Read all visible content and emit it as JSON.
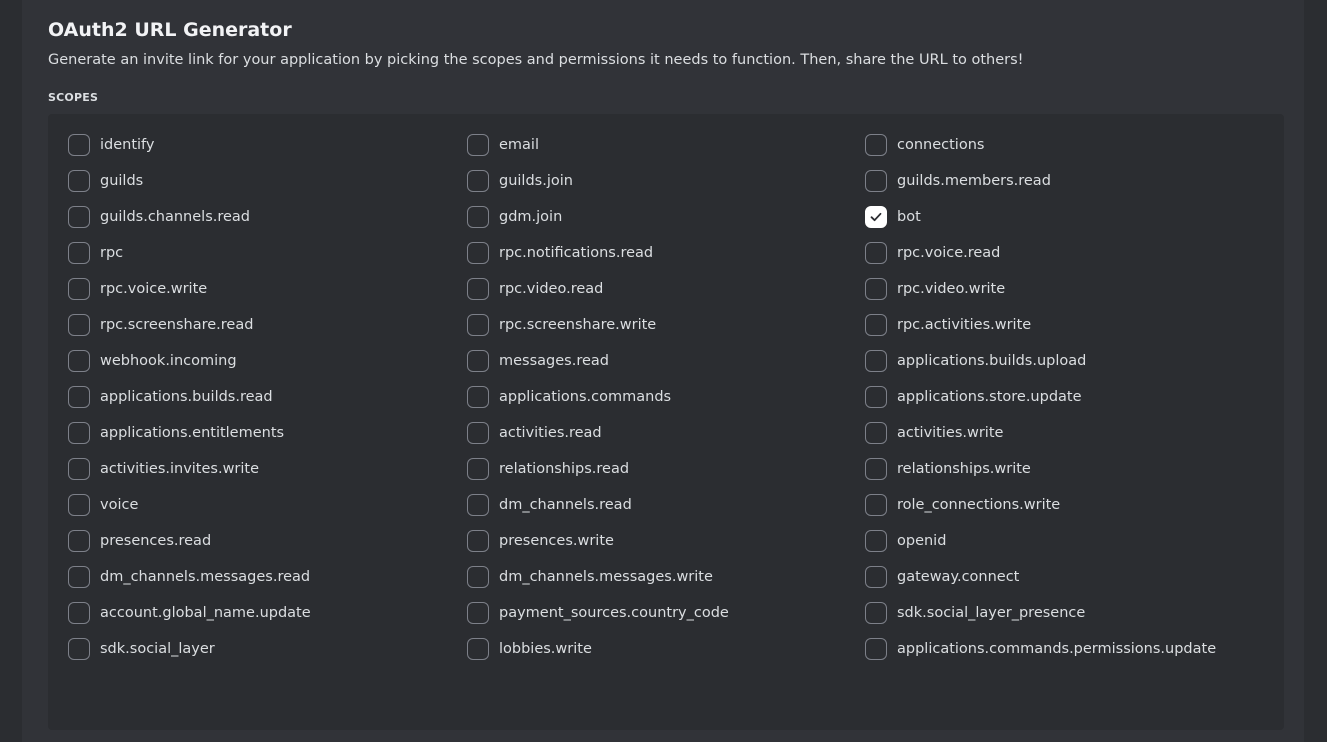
{
  "header": {
    "title": "OAuth2 URL Generator",
    "description": "Generate an invite link for your application by picking the scopes and permissions it needs to function. Then, share the URL to others!"
  },
  "scopes": {
    "label": "SCOPES",
    "items": [
      {
        "id": "identify",
        "label": "identify",
        "checked": false
      },
      {
        "id": "email",
        "label": "email",
        "checked": false
      },
      {
        "id": "connections",
        "label": "connections",
        "checked": false
      },
      {
        "id": "guilds",
        "label": "guilds",
        "checked": false
      },
      {
        "id": "guilds-join",
        "label": "guilds.join",
        "checked": false
      },
      {
        "id": "guilds-members-read",
        "label": "guilds.members.read",
        "checked": false
      },
      {
        "id": "guilds-channels-read",
        "label": "guilds.channels.read",
        "checked": false
      },
      {
        "id": "gdm-join",
        "label": "gdm.join",
        "checked": false
      },
      {
        "id": "bot",
        "label": "bot",
        "checked": true
      },
      {
        "id": "rpc",
        "label": "rpc",
        "checked": false
      },
      {
        "id": "rpc-notifications-read",
        "label": "rpc.notifications.read",
        "checked": false
      },
      {
        "id": "rpc-voice-read",
        "label": "rpc.voice.read",
        "checked": false
      },
      {
        "id": "rpc-voice-write",
        "label": "rpc.voice.write",
        "checked": false
      },
      {
        "id": "rpc-video-read",
        "label": "rpc.video.read",
        "checked": false
      },
      {
        "id": "rpc-video-write",
        "label": "rpc.video.write",
        "checked": false
      },
      {
        "id": "rpc-screenshare-read",
        "label": "rpc.screenshare.read",
        "checked": false
      },
      {
        "id": "rpc-screenshare-write",
        "label": "rpc.screenshare.write",
        "checked": false
      },
      {
        "id": "rpc-activities-write",
        "label": "rpc.activities.write",
        "checked": false
      },
      {
        "id": "webhook-incoming",
        "label": "webhook.incoming",
        "checked": false
      },
      {
        "id": "messages-read",
        "label": "messages.read",
        "checked": false
      },
      {
        "id": "applications-builds-upload",
        "label": "applications.builds.upload",
        "checked": false
      },
      {
        "id": "applications-builds-read",
        "label": "applications.builds.read",
        "checked": false
      },
      {
        "id": "applications-commands",
        "label": "applications.commands",
        "checked": false
      },
      {
        "id": "applications-store-update",
        "label": "applications.store.update",
        "checked": false
      },
      {
        "id": "applications-entitlements",
        "label": "applications.entitlements",
        "checked": false
      },
      {
        "id": "activities-read",
        "label": "activities.read",
        "checked": false
      },
      {
        "id": "activities-write",
        "label": "activities.write",
        "checked": false
      },
      {
        "id": "activities-invites-write",
        "label": "activities.invites.write",
        "checked": false
      },
      {
        "id": "relationships-read",
        "label": "relationships.read",
        "checked": false
      },
      {
        "id": "relationships-write",
        "label": "relationships.write",
        "checked": false
      },
      {
        "id": "voice",
        "label": "voice",
        "checked": false
      },
      {
        "id": "dm-channels-read",
        "label": "dm_channels.read",
        "checked": false
      },
      {
        "id": "role-connections-write",
        "label": "role_connections.write",
        "checked": false
      },
      {
        "id": "presences-read",
        "label": "presences.read",
        "checked": false
      },
      {
        "id": "presences-write",
        "label": "presences.write",
        "checked": false
      },
      {
        "id": "openid",
        "label": "openid",
        "checked": false
      },
      {
        "id": "dm-channels-messages-read",
        "label": "dm_channels.messages.read",
        "checked": false
      },
      {
        "id": "dm-channels-messages-write",
        "label": "dm_channels.messages.write",
        "checked": false
      },
      {
        "id": "gateway-connect",
        "label": "gateway.connect",
        "checked": false
      },
      {
        "id": "account-global-name-update",
        "label": "account.global_name.update",
        "checked": false
      },
      {
        "id": "payment-sources-country-code",
        "label": "payment_sources.country_code",
        "checked": false
      },
      {
        "id": "sdk-social-layer-presence",
        "label": "sdk.social_layer_presence",
        "checked": false
      },
      {
        "id": "sdk-social-layer",
        "label": "sdk.social_layer",
        "checked": false
      },
      {
        "id": "lobbies-write",
        "label": "lobbies.write",
        "checked": false
      },
      {
        "id": "applications-commands-permissions-update",
        "label": "applications.commands.permissions.update",
        "checked": false
      }
    ]
  }
}
